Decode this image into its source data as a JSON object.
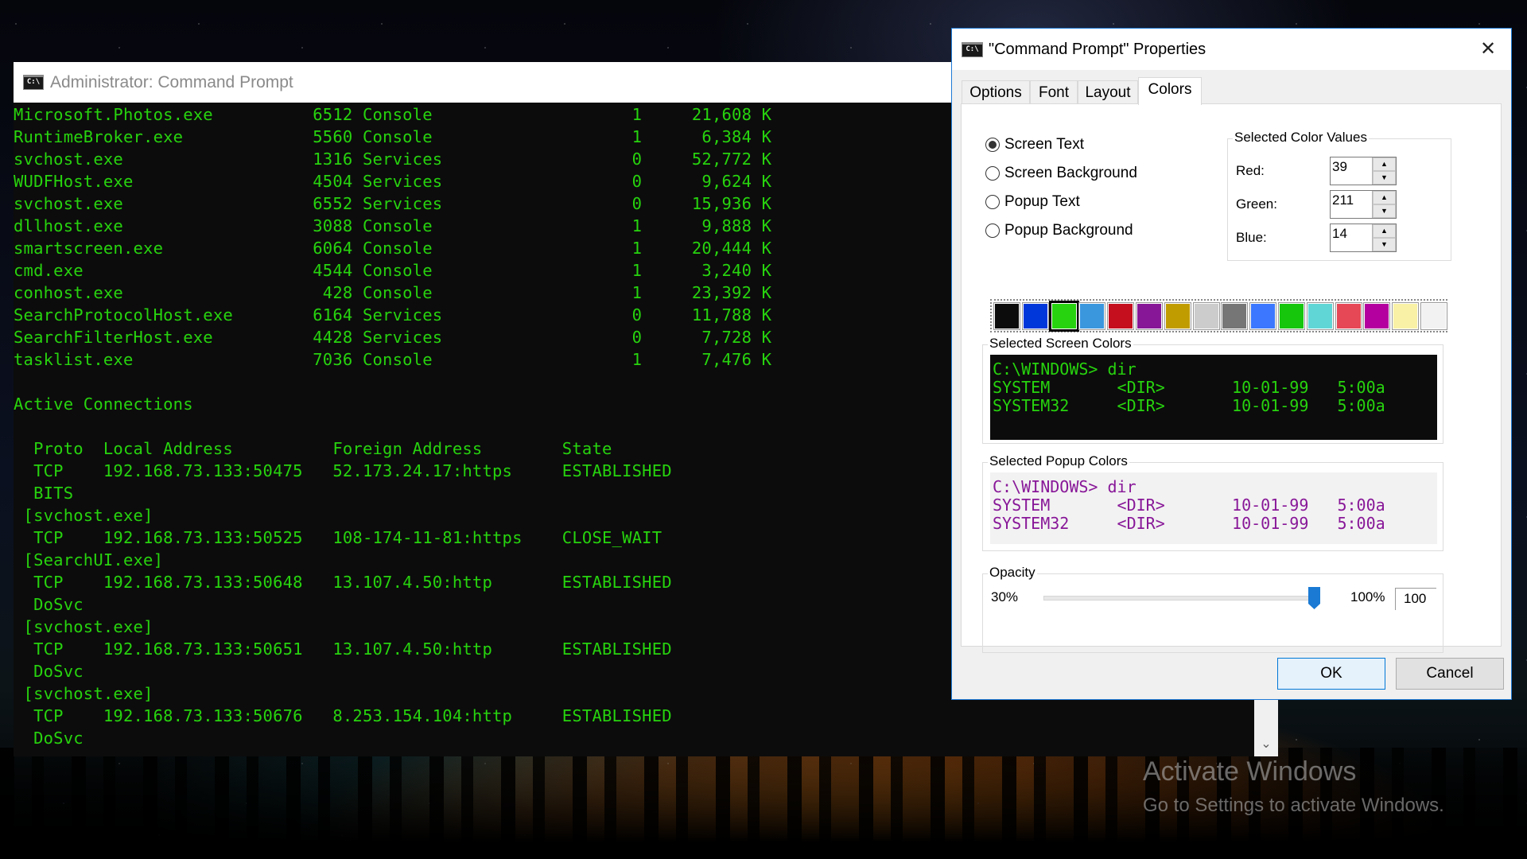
{
  "console": {
    "title": "Administrator: Command Prompt",
    "icon": "cmd-icon",
    "text_color": "#27d30e",
    "background_color": "#0c0c0c",
    "lines": [
      "Microsoft.Photos.exe          6512 Console                    1     21,608 K",
      "RuntimeBroker.exe             5560 Console                    1      6,384 K",
      "svchost.exe                   1316 Services                   0     52,772 K",
      "WUDFHost.exe                  4504 Services                   0      9,624 K",
      "svchost.exe                   6552 Services                   0     15,936 K",
      "dllhost.exe                   3088 Console                    1      9,888 K",
      "smartscreen.exe               6064 Console                    1     20,444 K",
      "cmd.exe                       4544 Console                    1      3,240 K",
      "conhost.exe                    428 Console                    1     23,392 K",
      "SearchProtocolHost.exe        6164 Services                   0     11,788 K",
      "SearchFilterHost.exe          4428 Services                   0      7,728 K",
      "tasklist.exe                  7036 Console                    1      7,476 K",
      "",
      "Active Connections",
      "",
      "  Proto  Local Address          Foreign Address        State",
      "  TCP    192.168.73.133:50475   52.173.24.17:https     ESTABLISHED",
      "  BITS",
      " [svchost.exe]",
      "  TCP    192.168.73.133:50525   108-174-11-81:https    CLOSE_WAIT",
      " [SearchUI.exe]",
      "  TCP    192.168.73.133:50648   13.107.4.50:http       ESTABLISHED",
      "  DoSvc",
      " [svchost.exe]",
      "  TCP    192.168.73.133:50651   13.107.4.50:http       ESTABLISHED",
      "  DoSvc",
      " [svchost.exe]",
      "  TCP    192.168.73.133:50676   8.253.154.104:http     ESTABLISHED",
      "  DoSvc"
    ],
    "scroll_down_icon": "chevron-down-icon"
  },
  "dialog": {
    "title": "\"Command Prompt\" Properties",
    "icon": "cmd-icon",
    "close_label": "✕",
    "tabs": [
      {
        "label": "Options",
        "active": false
      },
      {
        "label": "Font",
        "active": false
      },
      {
        "label": "Layout",
        "active": false
      },
      {
        "label": "Colors",
        "active": true
      }
    ],
    "color_targets": [
      {
        "label": "Screen Text",
        "selected": true
      },
      {
        "label": "Screen Background",
        "selected": false
      },
      {
        "label": "Popup Text",
        "selected": false
      },
      {
        "label": "Popup Background",
        "selected": false
      }
    ],
    "color_values": {
      "legend": "Selected Color Values",
      "red_label": "Red:",
      "red": "39",
      "green_label": "Green:",
      "green": "211",
      "blue_label": "Blue:",
      "blue": "14"
    },
    "palette": [
      "#0c0c0c",
      "#0037da",
      "#27d30e",
      "#3a96dd",
      "#c50f1f",
      "#881798",
      "#c19c00",
      "#cccccc",
      "#767676",
      "#3b78ff",
      "#16c60c",
      "#61d6d6",
      "#e74856",
      "#b4009e",
      "#f9f1a5",
      "#f2f2f2"
    ],
    "palette_selected_index": 2,
    "screen_preview": {
      "legend": "Selected Screen Colors",
      "text_color": "#27d30e",
      "background_color": "#0c0c0c",
      "lines": [
        "C:\\WINDOWS> dir",
        "SYSTEM       <DIR>       10-01-99   5:00a",
        "SYSTEM32     <DIR>       10-01-99   5:00a"
      ]
    },
    "popup_preview": {
      "legend": "Selected Popup Colors",
      "text_color": "#881798",
      "background_color": "#f2f2f2",
      "lines": [
        "C:\\WINDOWS> dir",
        "SYSTEM       <DIR>       10-01-99   5:00a",
        "SYSTEM32     <DIR>       10-01-99   5:00a"
      ]
    },
    "opacity": {
      "legend": "Opacity",
      "min_label": "30%",
      "max_label": "100%",
      "value": "100",
      "slider_percent": 100
    },
    "ok_label": "OK",
    "cancel_label": "Cancel"
  },
  "watermark": {
    "line1": "Activate Windows",
    "line2": "Go to Settings to activate Windows."
  }
}
